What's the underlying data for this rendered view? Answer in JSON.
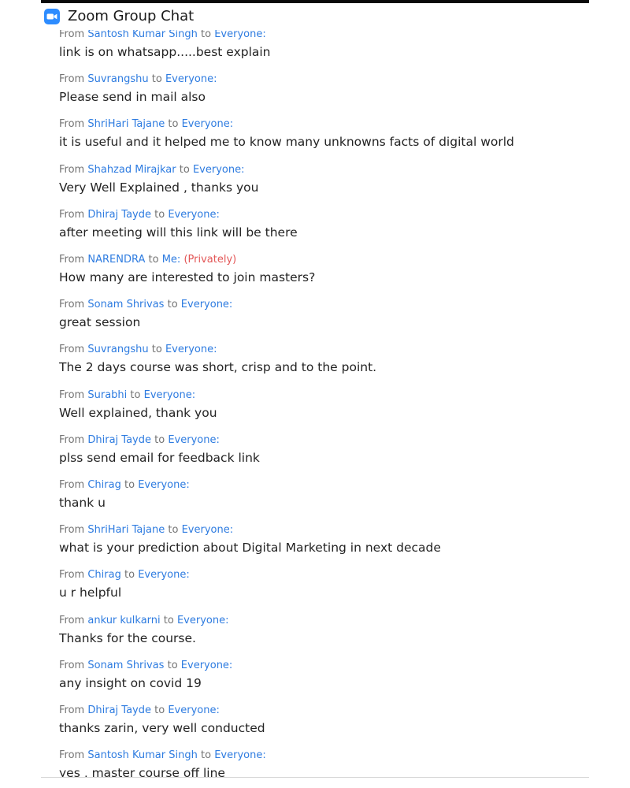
{
  "window": {
    "title": "Zoom Group Chat",
    "icon": "zoom-video-camera-icon",
    "icon_color": "#2d8cff"
  },
  "colors": {
    "name_link": "#2d7be0",
    "private_tag": "#e35757",
    "meta_text": "#747474",
    "message_text": "#232323"
  },
  "chat": {
    "messages": [
      {
        "from_label": "From",
        "sender": "Santosh Kumar Singh",
        "to_label": "to",
        "recipient": "Everyone:",
        "private": "",
        "text": "link is on whatsapp.....best explain"
      },
      {
        "from_label": "From",
        "sender": "Suvrangshu",
        "to_label": "to",
        "recipient": "Everyone:",
        "private": "",
        "text": "Please send in mail also"
      },
      {
        "from_label": "From",
        "sender": "ShriHari Tajane",
        "to_label": "to",
        "recipient": "Everyone:",
        "private": "",
        "text": "it is useful and it helped me to know many unknowns facts of digital world"
      },
      {
        "from_label": "From",
        "sender": "Shahzad Mirajkar",
        "to_label": "to",
        "recipient": "Everyone:",
        "private": "",
        "text": "Very Well Explained , thanks you"
      },
      {
        "from_label": "From",
        "sender": "Dhiraj Tayde",
        "to_label": "to",
        "recipient": "Everyone:",
        "private": "",
        "text": "after meeting will this link will be there"
      },
      {
        "from_label": "From",
        "sender": "NARENDRA",
        "to_label": "to",
        "recipient": "Me:",
        "private": "(Privately)",
        "text": "How many are interested to join masters?"
      },
      {
        "from_label": "From",
        "sender": "Sonam Shrivas",
        "to_label": "to",
        "recipient": "Everyone:",
        "private": "",
        "text": "great session"
      },
      {
        "from_label": "From",
        "sender": "Suvrangshu",
        "to_label": "to",
        "recipient": "Everyone:",
        "private": "",
        "text": "The 2 days course was short,  crisp and to the point."
      },
      {
        "from_label": "From",
        "sender": "Surabhi ",
        "to_label": "to",
        "recipient": "Everyone:",
        "private": "",
        "text": "Well explained, thank you"
      },
      {
        "from_label": "From",
        "sender": "Dhiraj Tayde",
        "to_label": "to",
        "recipient": "Everyone:",
        "private": "",
        "text": "plss send email for feedback link"
      },
      {
        "from_label": "From",
        "sender": "Chirag",
        "to_label": "to",
        "recipient": "Everyone:",
        "private": "",
        "text": "thank u"
      },
      {
        "from_label": "From",
        "sender": "ShriHari Tajane",
        "to_label": "to",
        "recipient": "Everyone:",
        "private": "",
        "text": "what is your prediction about Digital Marketing in next decade"
      },
      {
        "from_label": "From",
        "sender": "Chirag",
        "to_label": "to",
        "recipient": "Everyone:",
        "private": "",
        "text": "u r helpful"
      },
      {
        "from_label": "From",
        "sender": "ankur kulkarni",
        "to_label": "to",
        "recipient": "Everyone:",
        "private": "",
        "text": "Thanks for the course."
      },
      {
        "from_label": "From",
        "sender": "Sonam Shrivas",
        "to_label": "to",
        "recipient": "Everyone:",
        "private": "",
        "text": "any insight on covid 19"
      },
      {
        "from_label": "From",
        "sender": "Dhiraj Tayde",
        "to_label": "to",
        "recipient": "Everyone:",
        "private": "",
        "text": "thanks zarin, very well conducted"
      },
      {
        "from_label": "From",
        "sender": "Santosh Kumar Singh",
        "to_label": "to",
        "recipient": "Everyone:",
        "private": "",
        "text": "yes , master course  off line"
      }
    ]
  }
}
